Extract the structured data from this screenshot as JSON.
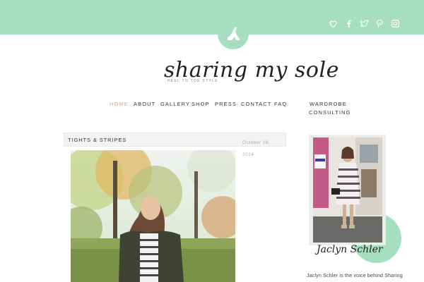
{
  "colors": {
    "accent": "#a5dfc0",
    "nav_active": "#d9a28d",
    "text": "#333333"
  },
  "social": [
    "heart-icon",
    "facebook-icon",
    "twitter-icon",
    "pinterest-icon",
    "instagram-icon"
  ],
  "logo": {
    "title": "sharing my sole",
    "tagline": "HEEL TO TOE STYLE"
  },
  "nav": {
    "home": "HOME",
    "about": "ABOUT",
    "gallery": "GALLERY",
    "shop": "SHOP",
    "press": "PRESS",
    "contact": "CONTACT",
    "faq": "FAQ",
    "wardrobe_line1": "WARDROBE",
    "wardrobe_line2": "CONSULTING"
  },
  "post": {
    "title": "TIGHTS & STRIPES",
    "date_line1": "October 28,",
    "date_line2": "2014"
  },
  "sidebar": {
    "signature": "Jaclyn Schler",
    "bio": "Jaclyn Schler is the voice behind Sharing"
  }
}
